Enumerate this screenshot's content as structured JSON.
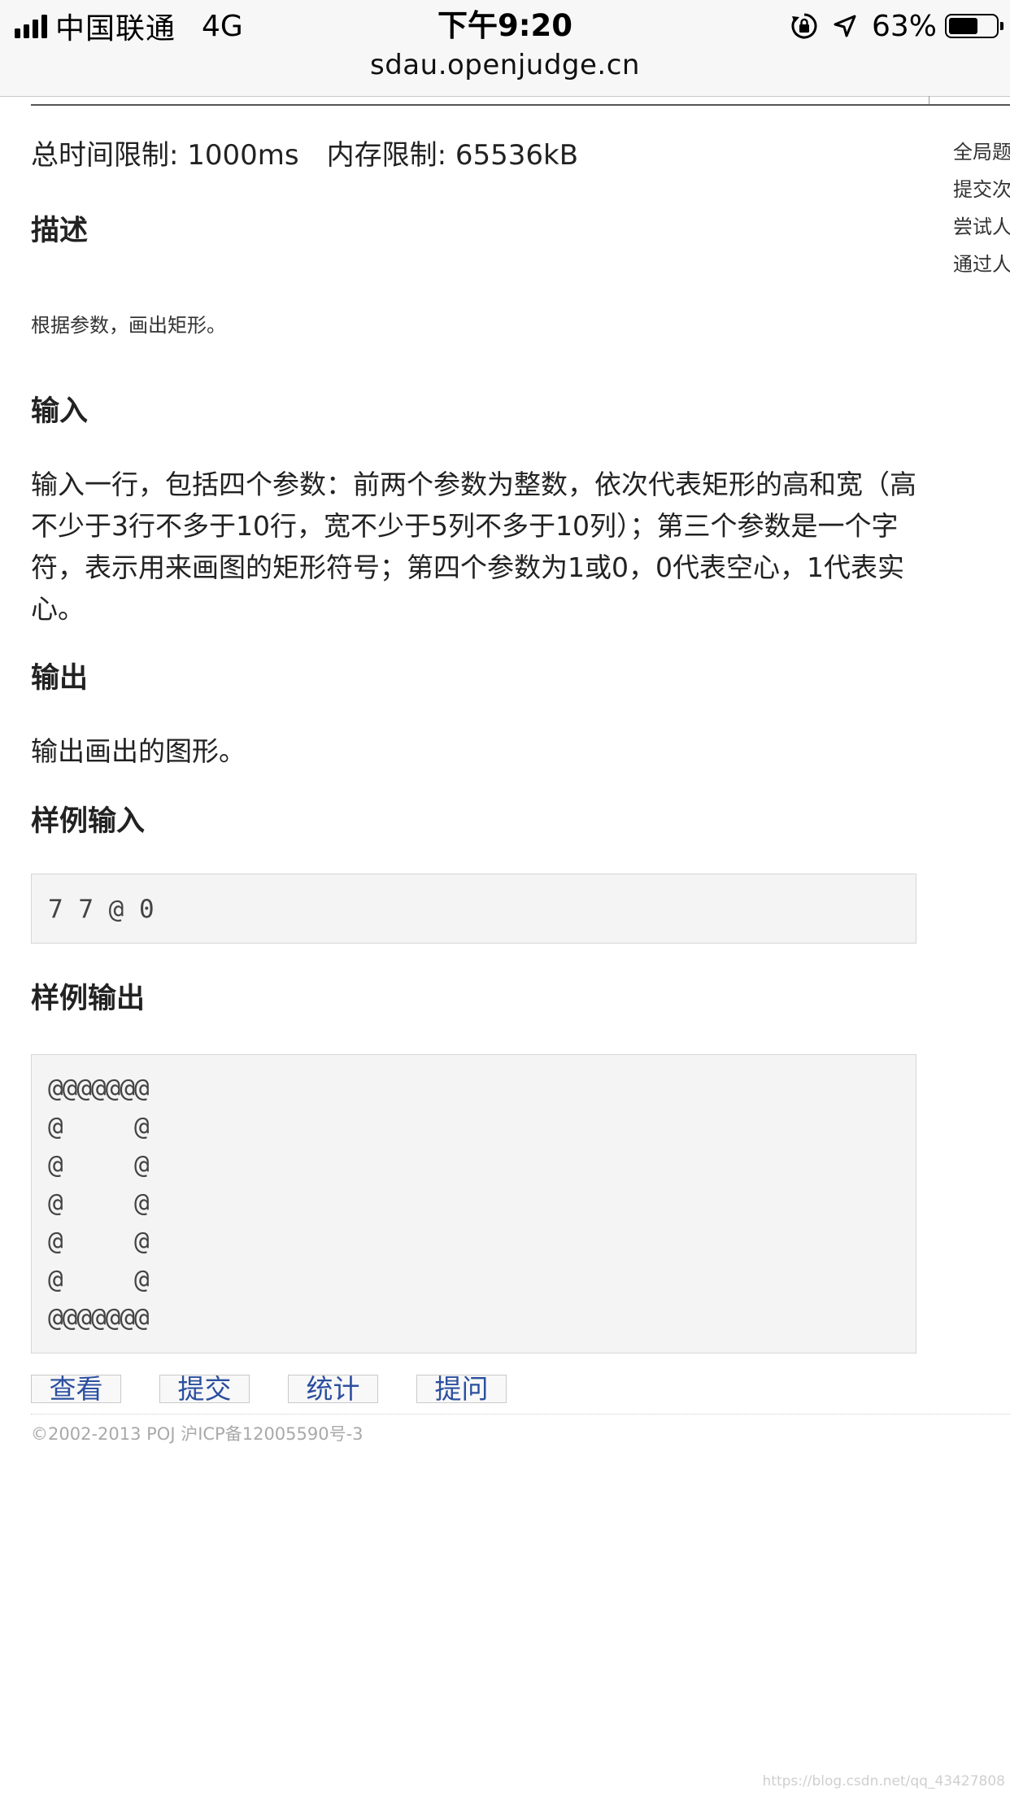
{
  "status_bar": {
    "carrier": "中国联通",
    "network": "4G",
    "time": "下午9:20",
    "battery": "63%",
    "battery_level": 0.63
  },
  "url": "sdau.openjudge.cn",
  "limits": {
    "time": "总时间限制: 1000ms",
    "memory": "内存限制: 65536kB"
  },
  "description": {
    "title": "描述",
    "text": "根据参数，画出矩形。"
  },
  "input": {
    "title": "输入",
    "text": "输入一行，包括四个参数：前两个参数为整数，依次代表矩形的高和宽（高不少于3行不多于10行，宽不少于5列不多于10列）；第三个参数是一个字符，表示用来画图的矩形符号；第四个参数为1或0，0代表空心，1代表实心。"
  },
  "output": {
    "title": "输出",
    "text": "输出画出的图形。"
  },
  "sample_input": {
    "title": "样例输入",
    "text": "7 7 @ 0"
  },
  "sample_output": {
    "title": "样例输出",
    "text": "@@@@@@@\n@     @\n@     @\n@     @\n@     @\n@     @\n@@@@@@@"
  },
  "actions": {
    "view": "查看",
    "submit": "提交",
    "stats": "统计",
    "ask": "提问"
  },
  "footer": {
    "copyright": "©2002-2013 POJ 沪ICP备12005590号-3"
  },
  "side_panel": {
    "items": [
      "全局题号",
      "提交次数",
      "尝试人数",
      "通过人数"
    ]
  },
  "watermark": "https://blog.csdn.net/qq_43427808"
}
